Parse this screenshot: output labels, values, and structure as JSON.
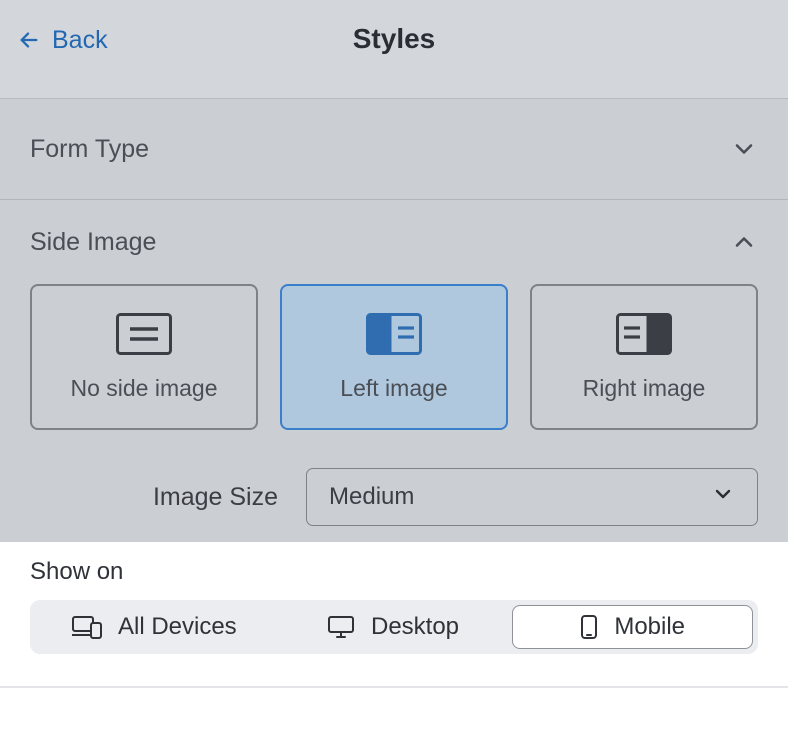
{
  "header": {
    "back_label": "Back",
    "title": "Styles"
  },
  "accordion": {
    "form_type_label": "Form Type",
    "side_image_label": "Side Image"
  },
  "side_image_options": {
    "none": "No side image",
    "left": "Left image",
    "right": "Right image",
    "selected": "left"
  },
  "image_size": {
    "label": "Image Size",
    "value": "Medium"
  },
  "show_on": {
    "label": "Show on",
    "all": "All Devices",
    "desktop": "Desktop",
    "mobile": "Mobile",
    "selected": "mobile"
  }
}
